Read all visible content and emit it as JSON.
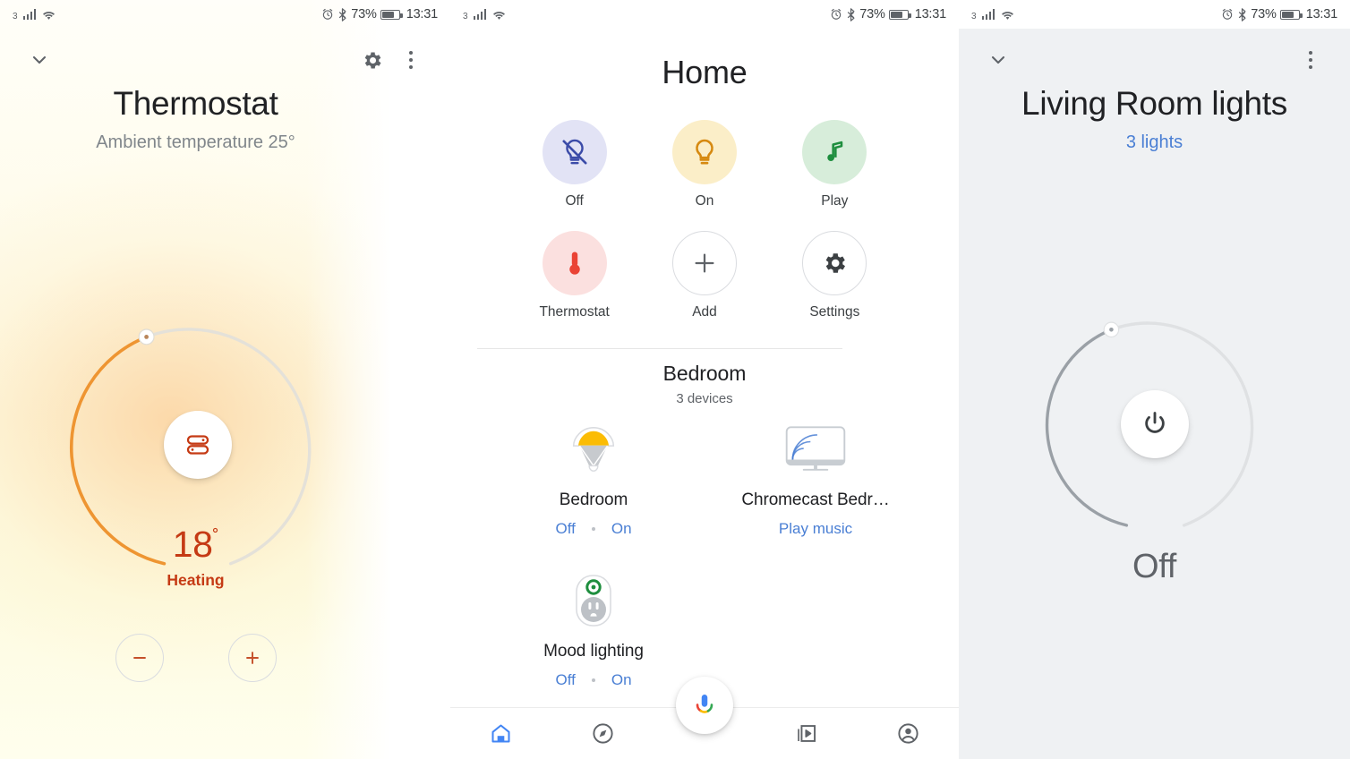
{
  "status_bar": {
    "network_label": "3",
    "signal_icon": "signal-bars-icon",
    "wifi_icon": "wifi-icon",
    "alarm_icon": "alarm-clock-icon",
    "bluetooth_icon": "bluetooth-icon",
    "battery_percent": "73%",
    "battery_icon": "battery-icon",
    "time": "13:31"
  },
  "thermostat_screen": {
    "collapse_icon": "chevron-down-icon",
    "settings_icon": "gear-icon",
    "overflow_icon": "more-vert-icon",
    "title": "Thermostat",
    "subtitle": "Ambient temperature 25°",
    "dial": {
      "center_icon": "radiator-heating-icon",
      "handle_icon": "dial-handle",
      "progress_color": "#ee9532",
      "track_color": "#e3e0d8"
    },
    "temperature": "18",
    "degree_symbol": "˚",
    "state": "Heating",
    "decrease_label": "−",
    "decrease_icon": "minus-icon",
    "increase_label": "+",
    "increase_icon": "plus-icon",
    "accent_color": "#c53a14"
  },
  "home_screen": {
    "title": "Home",
    "quick_actions": [
      {
        "label": "Off",
        "icon": "lightbulb-off-icon",
        "circle_color": "#e2e3f5",
        "icon_color": "#3b4ba8",
        "outline": false
      },
      {
        "label": "On",
        "icon": "lightbulb-icon",
        "circle_color": "#fbeec8",
        "icon_color": "#d68910",
        "outline": false
      },
      {
        "label": "Play",
        "icon": "music-note-icon",
        "circle_color": "#d7edda",
        "icon_color": "#1e8e3e",
        "outline": false
      },
      {
        "label": "Thermostat",
        "icon": "thermometer-icon",
        "circle_color": "#fbe0df",
        "icon_color": "#ea4335",
        "outline": false
      },
      {
        "label": "Add",
        "icon": "plus-icon",
        "circle_color": "#ffffff",
        "icon_color": "#5f6368",
        "outline": true
      },
      {
        "label": "Settings",
        "icon": "gear-icon",
        "circle_color": "#ffffff",
        "icon_color": "#3c4043",
        "outline": true
      }
    ],
    "room": {
      "name": "Bedroom",
      "device_count": "3 devices"
    },
    "devices": [
      {
        "name": "Bedroom",
        "icon": "pendant-lamp-icon",
        "action_off": "Off",
        "action_on": "On"
      },
      {
        "name": "Chromecast Bedr…",
        "icon": "chromecast-monitor-icon",
        "action_single": "Play music"
      },
      {
        "name": "Mood lighting",
        "icon": "smart-plug-icon",
        "action_off": "Off",
        "action_on": "On"
      }
    ],
    "nav": [
      {
        "label": "Home",
        "icon": "home-icon",
        "active": true
      },
      {
        "label": "Explore",
        "icon": "compass-icon",
        "active": false
      },
      {
        "label": "Assistant",
        "icon": "microphone-icon",
        "active": false
      },
      {
        "label": "Media",
        "icon": "media-library-icon",
        "active": false
      },
      {
        "label": "Account",
        "icon": "account-circle-icon",
        "active": false
      }
    ],
    "link_color": "#4a7fd4"
  },
  "lights_screen": {
    "collapse_icon": "chevron-down-icon",
    "overflow_icon": "more-vert-icon",
    "title": "Living Room lights",
    "subtitle": "3 lights",
    "dial": {
      "center_icon": "power-icon",
      "handle_icon": "dial-handle",
      "progress_color": "#9aa0a6",
      "track_color": "#dfe1e3"
    },
    "state": "Off",
    "background_color": "#eff1f3"
  }
}
